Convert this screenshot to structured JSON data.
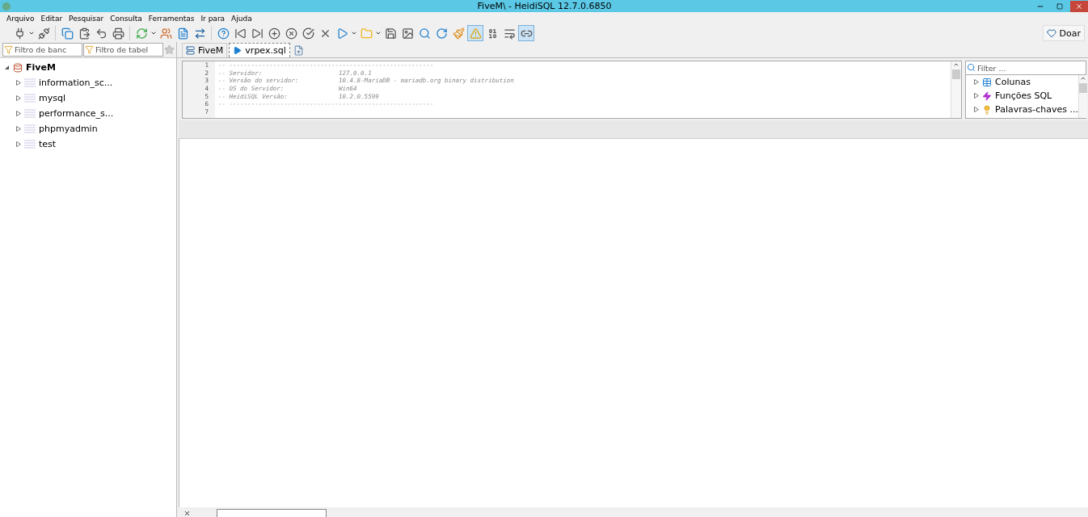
{
  "window": {
    "title": "FiveM\\ - HeidiSQL 12.7.0.6850"
  },
  "menu": [
    "Arquivo",
    "Editar",
    "Pesquisar",
    "Consulta",
    "Ferramentas",
    "Ir para",
    "Ajuda"
  ],
  "toolbar": [
    {
      "kind": "plug"
    },
    {
      "kind": "caret"
    },
    {
      "kind": "unplug"
    },
    {
      "kind": "sep"
    },
    {
      "kind": "copy"
    },
    {
      "kind": "paste"
    },
    {
      "kind": "undo"
    },
    {
      "kind": "print"
    },
    {
      "kind": "sep"
    },
    {
      "kind": "refresh"
    },
    {
      "kind": "caret"
    },
    {
      "kind": "users"
    },
    {
      "kind": "file"
    },
    {
      "kind": "transfer"
    },
    {
      "kind": "sep"
    },
    {
      "kind": "help"
    },
    {
      "kind": "first"
    },
    {
      "kind": "last"
    },
    {
      "kind": "plus"
    },
    {
      "kind": "cancel"
    },
    {
      "kind": "check"
    },
    {
      "kind": "x"
    },
    {
      "kind": "play"
    },
    {
      "kind": "caret"
    },
    {
      "kind": "folder"
    },
    {
      "kind": "caret"
    },
    {
      "kind": "save"
    },
    {
      "kind": "image"
    },
    {
      "kind": "search"
    },
    {
      "kind": "replace"
    },
    {
      "kind": "brush"
    },
    {
      "kind": "warning",
      "on": true
    },
    {
      "kind": "binary",
      "on": false
    },
    {
      "kind": "wrap",
      "on": false
    },
    {
      "kind": "link",
      "on": true
    }
  ],
  "donate_button": "Doar",
  "db_filter": {
    "placeholder": "Filtro de banc"
  },
  "table_filter": {
    "placeholder": "Filtro de tabel"
  },
  "tabs": [
    {
      "label": "FiveM",
      "kind": "server",
      "selected": false
    },
    {
      "label": "vrpex.sql",
      "kind": "query",
      "selected": true
    }
  ],
  "tree": {
    "label": "FiveM",
    "expanded": true,
    "children": [
      {
        "label": "information_sc...",
        "expanded": false
      },
      {
        "label": "mysql",
        "expanded": false
      },
      {
        "label": "performance_s...",
        "expanded": false
      },
      {
        "label": "phpmyadmin",
        "expanded": false
      },
      {
        "label": "test",
        "expanded": false
      }
    ]
  },
  "editor": {
    "lines": [
      "-- --------------------------------------------------------",
      "-- Servidor:                     127.0.0.1",
      "-- Versão do servidor:           10.4.8-MariaDB - mariadb.org binary distribution",
      "-- OS do Servidor:               Win64",
      "-- HeidiSQL Versão:              10.2.0.5599",
      "-- --------------------------------------------------------"
    ],
    "line_numbers": [
      "1",
      "2",
      "3",
      "4",
      "5",
      "6",
      "7"
    ]
  },
  "helpers": {
    "filter": {
      "placeholder": "Filter ..."
    },
    "items": [
      {
        "label": "Colunas",
        "kind": "columns",
        "expanded": false
      },
      {
        "label": "Funções SQL",
        "kind": "functions",
        "expanded": false
      },
      {
        "label": "Palavras-chaves ...",
        "kind": "keywords",
        "expanded": false
      }
    ]
  }
}
